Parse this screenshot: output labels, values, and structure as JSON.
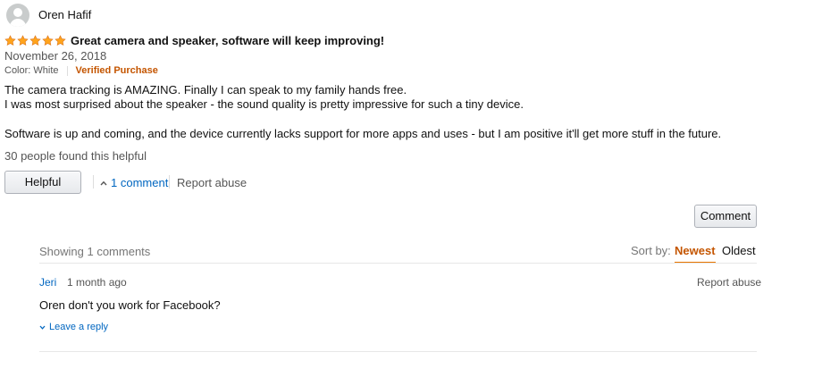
{
  "review": {
    "reviewer_name": "Oren Hafif",
    "rating": 5,
    "star_color": "#ffa41c",
    "title": "Great camera and speaker, software will keep improving!",
    "date": "November 26, 2018",
    "color_label": "Color: White",
    "verified_label": "Verified Purchase",
    "body": [
      "The camera tracking is AMAZING. Finally I can speak to my family hands free.",
      "I was most surprised about the speaker - the sound quality is pretty impressive for such a tiny device.",
      "Software is up and coming, and the device currently lacks support for more apps and uses - but I am positive it'll get more stuff in the future."
    ],
    "helpful_count": "30 people found this helpful",
    "helpful_button": "Helpful",
    "comments_link": "1 comment",
    "report_abuse": "Report abuse"
  },
  "comments_section": {
    "comment_button": "Comment",
    "showing_label": "Showing 1 comments",
    "sort_label": "Sort by:",
    "sort_options": [
      "Newest",
      "Oldest"
    ],
    "sort_selected": "Newest",
    "comments": [
      {
        "author": "Jeri",
        "time": "1 month ago",
        "text": "Oren don't you work for Facebook?",
        "report_label": "Report abuse",
        "reply_label": "Leave a reply"
      }
    ]
  },
  "colors": {
    "link": "#0066c0",
    "accent_orange": "#c45500",
    "sort_underline": "#e77600"
  }
}
